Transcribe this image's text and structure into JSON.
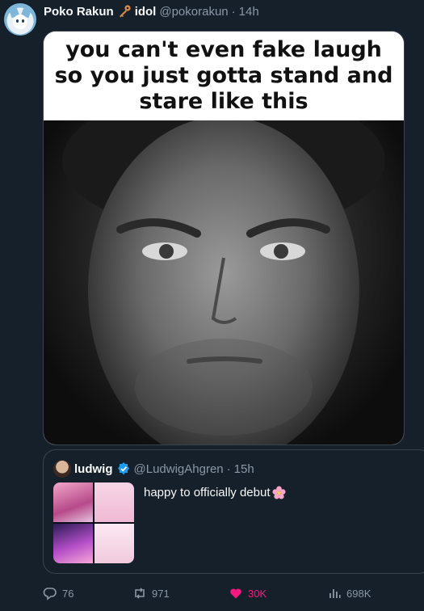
{
  "tweet": {
    "author": {
      "name": "Poko Rakun",
      "badge_text": "idol",
      "handle": "@pokorakun",
      "separator": "·",
      "time": "14h"
    },
    "media": {
      "caption": "you can't even fake laugh so you just gotta stand and stare like this"
    },
    "quoted": {
      "author_name": "ludwig",
      "handle": "@LudwigAhgren",
      "separator": "·",
      "time": "15h",
      "text": "happy to officially debut"
    },
    "actions": {
      "replies": "76",
      "retweets": "971",
      "likes": "30K",
      "views": "698K"
    }
  },
  "icons": {
    "key": "key-icon",
    "verified": "verified-icon",
    "flower": "cherry-blossom-icon",
    "reply": "reply-icon",
    "retweet": "retweet-icon",
    "like": "heart-icon",
    "views": "views-icon"
  },
  "colors": {
    "background": "#15202b",
    "muted": "#8b98a5",
    "border": "#38444d",
    "like": "#f91880",
    "verified": "#1d9bf0"
  }
}
